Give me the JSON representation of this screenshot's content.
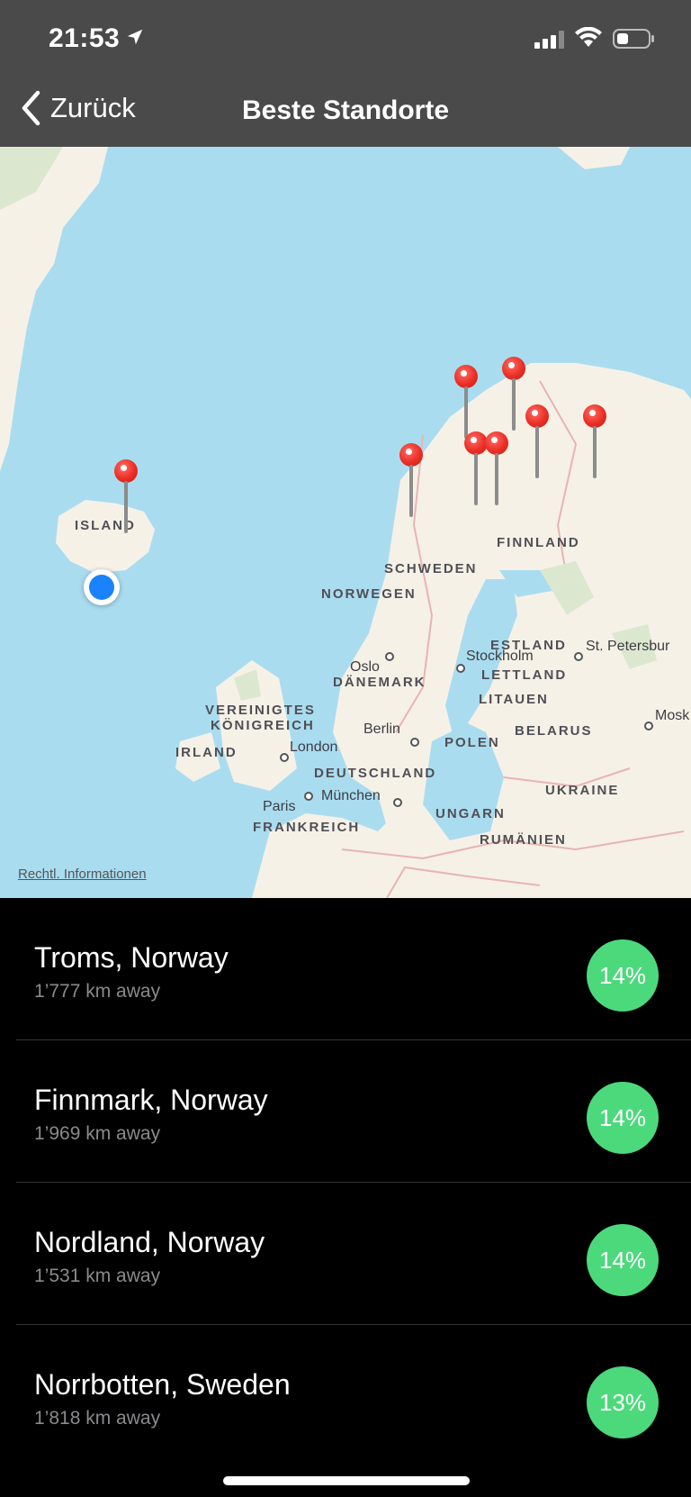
{
  "status_bar": {
    "time": "21:53",
    "icons": [
      "location-arrow-icon",
      "cellular-signal-icon",
      "wifi-icon",
      "battery-icon"
    ]
  },
  "nav": {
    "back_label": "Zurück",
    "title": "Beste Standorte"
  },
  "map": {
    "legal_link": "Rechtl. Informationen",
    "country_labels": {
      "island": "ISLAND",
      "finnland": "FINNLAND",
      "schweden": "SCHWEDEN",
      "norwegen": "NORWEGEN",
      "estland": "ESTLAND",
      "lettland": "LETTLAND",
      "litauen": "LITAUEN",
      "daenemark": "DÄNEMARK",
      "vk_line1": "VEREINIGTES",
      "vk_line2": "KÖNIGREICH",
      "irland": "IRLAND",
      "belarus": "BELARUS",
      "polen": "POLEN",
      "deutschland": "DEUTSCHLAND",
      "ukraine": "UKRAINE",
      "ungarn": "UNGARN",
      "frankreich": "FRANKREICH",
      "rumaenien": "RUMÄNIEN"
    },
    "city_labels": {
      "oslo": "Oslo",
      "stockholm": "Stockholm",
      "st_petersburg": "St. Petersbur",
      "moskau": "Mosk",
      "berlin": "Berlin",
      "london": "London",
      "muenchen": "München",
      "paris": "Paris"
    },
    "colors": {
      "water": "#aadcf0",
      "land": "#f6f1e7",
      "pin": "#ea2e25",
      "user_location": "#1a82fb"
    }
  },
  "locations": [
    {
      "name": "Troms, Norway",
      "distance": "1’777 km away",
      "percent": "14%"
    },
    {
      "name": "Finnmark, Norway",
      "distance": "1’969 km away",
      "percent": "14%"
    },
    {
      "name": "Nordland, Norway",
      "distance": "1’531 km away",
      "percent": "14%"
    },
    {
      "name": "Norrbotten, Sweden",
      "distance": "1’818 km away",
      "percent": "13%"
    }
  ],
  "badge_color": "#4cd97c"
}
